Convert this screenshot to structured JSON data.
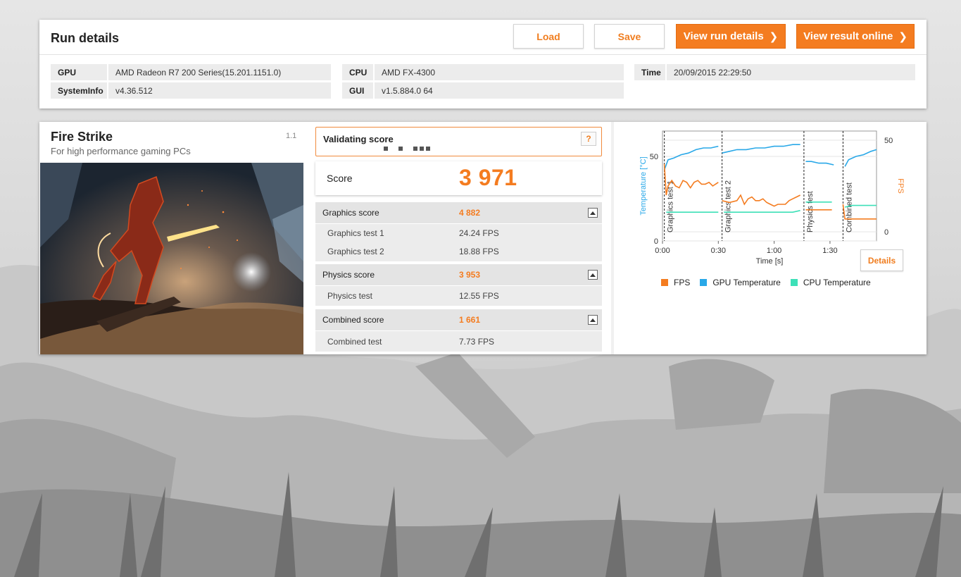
{
  "run_details": {
    "title": "Run details",
    "buttons": {
      "load": "Load",
      "save": "Save",
      "view_run_details": "View run details",
      "view_result_online": "View result online"
    },
    "info": {
      "gpu_label": "GPU",
      "gpu_value": "AMD Radeon R7 200 Series(15.201.1151.0)",
      "systeminfo_label": "SystemInfo",
      "systeminfo_value": "v4.36.512",
      "cpu_label": "CPU",
      "cpu_value": "AMD FX-4300",
      "gui_label": "GUI",
      "gui_value": "v1.5.884.0 64",
      "time_label": "Time",
      "time_value": "20/09/2015 22:29:50"
    }
  },
  "test": {
    "title": "Fire Strike",
    "subtitle": "For high performance gaming PCs",
    "version": "1.1"
  },
  "validation": {
    "label": "Validating score",
    "help": "?"
  },
  "score": {
    "label": "Score",
    "value": "3 971"
  },
  "breakdown": {
    "graphics_label": "Graphics score",
    "graphics_value": "4 882",
    "gt1_label": "Graphics test 1",
    "gt1_value": "24.24 FPS",
    "gt2_label": "Graphics test 2",
    "gt2_value": "18.88 FPS",
    "physics_label": "Physics score",
    "physics_value": "3 953",
    "pt_label": "Physics test",
    "pt_value": "12.55 FPS",
    "combined_label": "Combined score",
    "combined_value": "1 661",
    "ct_label": "Combined test",
    "ct_value": "7.73 FPS"
  },
  "details_button": "Details",
  "colors": {
    "accent": "#f47c20",
    "fps": "#f47c20",
    "gpu_temp": "#29a8e8",
    "cpu_temp": "#3de0b8"
  },
  "chart_data": {
    "type": "line",
    "xlabel": "Time [s]",
    "ylabel_left": "Temperature [°C]",
    "ylabel_right": "FPS",
    "x_ticks": [
      "0:00",
      "0:30",
      "1:00",
      "1:30"
    ],
    "x_tick_seconds": [
      0,
      30,
      60,
      90
    ],
    "xlim": [
      0,
      115
    ],
    "ylim_left": [
      0,
      65
    ],
    "ylim_right": [
      -5,
      55
    ],
    "y_ticks_left": [
      0,
      50
    ],
    "y_ticks_right": [
      0,
      50
    ],
    "phase_labels": [
      "Graphics test 1",
      "Graphics test 2",
      "Physics test",
      "Combined test"
    ],
    "phase_starts_seconds": [
      1,
      32,
      76,
      97
    ],
    "series": [
      {
        "name": "GPU Temperature",
        "axis": "left",
        "segments": [
          [
            [
              1,
              42
            ],
            [
              3,
              48
            ],
            [
              6,
              49
            ],
            [
              10,
              51
            ],
            [
              14,
              52
            ],
            [
              18,
              54
            ],
            [
              22,
              55
            ],
            [
              26,
              55
            ],
            [
              30,
              56
            ]
          ],
          [
            [
              32,
              52
            ],
            [
              36,
              53
            ],
            [
              40,
              54
            ],
            [
              45,
              54
            ],
            [
              50,
              55
            ],
            [
              55,
              55
            ],
            [
              60,
              56
            ],
            [
              65,
              56
            ],
            [
              70,
              57
            ],
            [
              74,
              57
            ]
          ],
          [
            [
              77,
              47
            ],
            [
              80,
              47
            ],
            [
              84,
              46
            ],
            [
              88,
              46
            ],
            [
              92,
              45
            ]
          ],
          [
            [
              98,
              44
            ],
            [
              100,
              48
            ],
            [
              104,
              50
            ],
            [
              108,
              51
            ],
            [
              112,
              53
            ],
            [
              115,
              54
            ]
          ]
        ]
      },
      {
        "name": "CPU Temperature",
        "axis": "left",
        "segments": [
          [
            [
              2,
              17
            ],
            [
              8,
              17
            ],
            [
              14,
              17
            ],
            [
              20,
              17
            ],
            [
              26,
              17
            ],
            [
              30,
              17
            ]
          ],
          [
            [
              33,
              17
            ],
            [
              40,
              17
            ],
            [
              48,
              17
            ],
            [
              56,
              17
            ],
            [
              64,
              17
            ],
            [
              70,
              17
            ],
            [
              74,
              18
            ]
          ],
          [
            [
              77,
              23
            ],
            [
              82,
              23
            ],
            [
              86,
              23
            ],
            [
              91,
              23
            ]
          ],
          [
            [
              98,
              20
            ],
            [
              102,
              21
            ],
            [
              106,
              21
            ],
            [
              110,
              21
            ],
            [
              115,
              21
            ]
          ]
        ]
      },
      {
        "name": "FPS",
        "axis": "right",
        "segments": [
          [
            [
              1,
              37
            ],
            [
              2,
              20
            ],
            [
              3,
              25
            ],
            [
              5,
              28
            ],
            [
              7,
              25
            ],
            [
              9,
              24
            ],
            [
              11,
              28
            ],
            [
              13,
              27
            ],
            [
              15,
              24
            ],
            [
              17,
              27
            ],
            [
              19,
              28
            ],
            [
              21,
              26
            ],
            [
              23,
              26
            ],
            [
              25,
              27
            ],
            [
              27,
              25
            ],
            [
              30,
              27
            ]
          ],
          [
            [
              32,
              17
            ],
            [
              36,
              16
            ],
            [
              40,
              17
            ],
            [
              42,
              20
            ],
            [
              44,
              15
            ],
            [
              46,
              18
            ],
            [
              48,
              19
            ],
            [
              50,
              17
            ],
            [
              52,
              17
            ],
            [
              54,
              18
            ],
            [
              56,
              16
            ],
            [
              58,
              15
            ],
            [
              60,
              14
            ],
            [
              62,
              15
            ],
            [
              66,
              15
            ],
            [
              68,
              17
            ],
            [
              70,
              18
            ],
            [
              72,
              19
            ],
            [
              74,
              20
            ]
          ],
          [
            [
              77,
              12
            ],
            [
              82,
              12
            ],
            [
              86,
              12
            ],
            [
              91,
              12
            ]
          ],
          [
            [
              97,
              15
            ],
            [
              98,
              7
            ],
            [
              102,
              7
            ],
            [
              106,
              7
            ],
            [
              110,
              7
            ],
            [
              115,
              7
            ]
          ]
        ]
      }
    ]
  }
}
